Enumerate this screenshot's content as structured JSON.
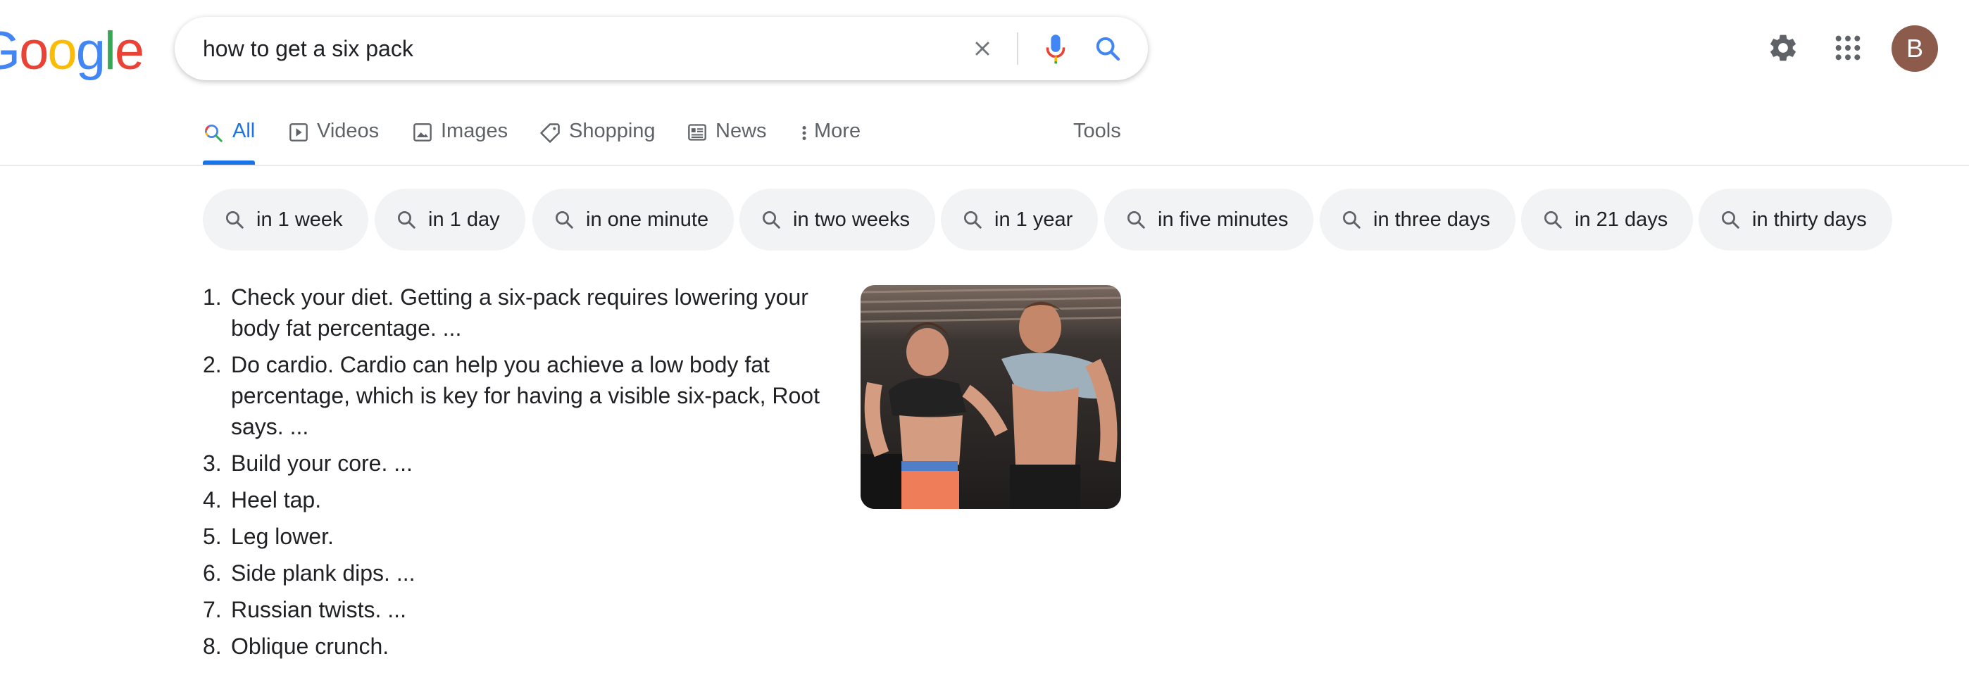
{
  "logo": {
    "text": "Google",
    "letters": [
      "G",
      "o",
      "o",
      "g",
      "l",
      "e"
    ],
    "colors": [
      "#4285f4",
      "#ea4335",
      "#fbbc05",
      "#4285f4",
      "#34a853",
      "#ea4335"
    ]
  },
  "search": {
    "query": "how to get a six pack"
  },
  "header": {
    "avatar_letter": "B"
  },
  "tabs": [
    {
      "label": "All",
      "icon": "search-icon",
      "active": true
    },
    {
      "label": "Videos",
      "icon": "video-icon"
    },
    {
      "label": "Images",
      "icon": "image-icon"
    },
    {
      "label": "Shopping",
      "icon": "tag-icon"
    },
    {
      "label": "News",
      "icon": "news-icon"
    },
    {
      "label": "More",
      "icon": "more-vert-icon"
    },
    {
      "label": "Tools"
    }
  ],
  "chips": [
    {
      "label": "in 1 week"
    },
    {
      "label": "in 1 day"
    },
    {
      "label": "in one minute"
    },
    {
      "label": "in two weeks"
    },
    {
      "label": "in 1 year"
    },
    {
      "label": "in five minutes"
    },
    {
      "label": "in three days"
    },
    {
      "label": "in 21 days"
    },
    {
      "label": "in thirty days"
    }
  ],
  "steps": [
    {
      "num": "1.",
      "text": "Check your diet. Getting a six-pack requires lowering your body fat percentage. ..."
    },
    {
      "num": "2.",
      "text": "Do cardio. Cardio can help you achieve a low body fat percentage, which is key for having a visible six-pack, Root says. ..."
    },
    {
      "num": "3.",
      "text": "Build your core. ..."
    },
    {
      "num": "4.",
      "text": "Heel tap."
    },
    {
      "num": "5.",
      "text": "Leg lower."
    },
    {
      "num": "6.",
      "text": "Side plank dips. ..."
    },
    {
      "num": "7.",
      "text": "Russian twists. ..."
    },
    {
      "num": "8.",
      "text": "Oblique crunch."
    }
  ],
  "colors": {
    "accent": "#1a73e8",
    "chip_bg": "#f1f3f4",
    "avatar_bg": "#8d5b4c"
  }
}
